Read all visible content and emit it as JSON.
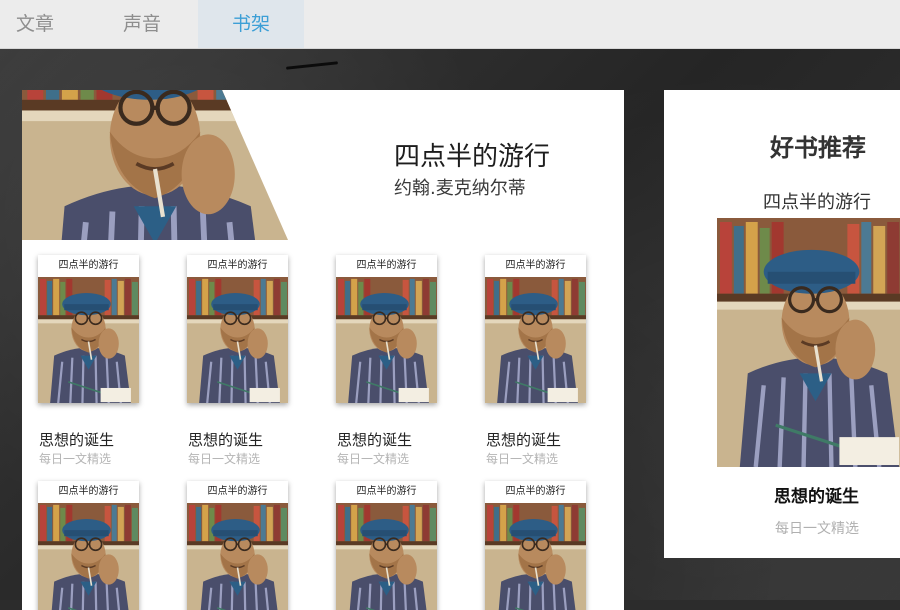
{
  "tabs": [
    {
      "label": "文章",
      "active": false
    },
    {
      "label": "声音",
      "active": false
    },
    {
      "label": "书架",
      "active": true
    }
  ],
  "colors": {
    "accent": "#3c9fd6",
    "tab_active_bg": "#dfe6ec"
  },
  "featured": {
    "title": "四点半的游行",
    "author": "约翰.麦克纳尔蒂"
  },
  "books": [
    {
      "cover_title": "四点半的游行",
      "name": "思想的诞生",
      "subtitle": "每日一文精选"
    },
    {
      "cover_title": "四点半的游行",
      "name": "思想的诞生",
      "subtitle": "每日一文精选"
    },
    {
      "cover_title": "四点半的游行",
      "name": "思想的诞生",
      "subtitle": "每日一文精选"
    },
    {
      "cover_title": "四点半的游行",
      "name": "思想的诞生",
      "subtitle": "每日一文精选"
    },
    {
      "cover_title": "四点半的游行",
      "name": "",
      "subtitle": ""
    },
    {
      "cover_title": "四点半的游行",
      "name": "",
      "subtitle": ""
    },
    {
      "cover_title": "四点半的游行",
      "name": "",
      "subtitle": ""
    },
    {
      "cover_title": "四点半的游行",
      "name": "",
      "subtitle": ""
    }
  ],
  "recommend": {
    "heading": "好书推荐",
    "book_title": "四点半的游行",
    "name": "思想的诞生",
    "subtitle": "每日一文精选"
  }
}
